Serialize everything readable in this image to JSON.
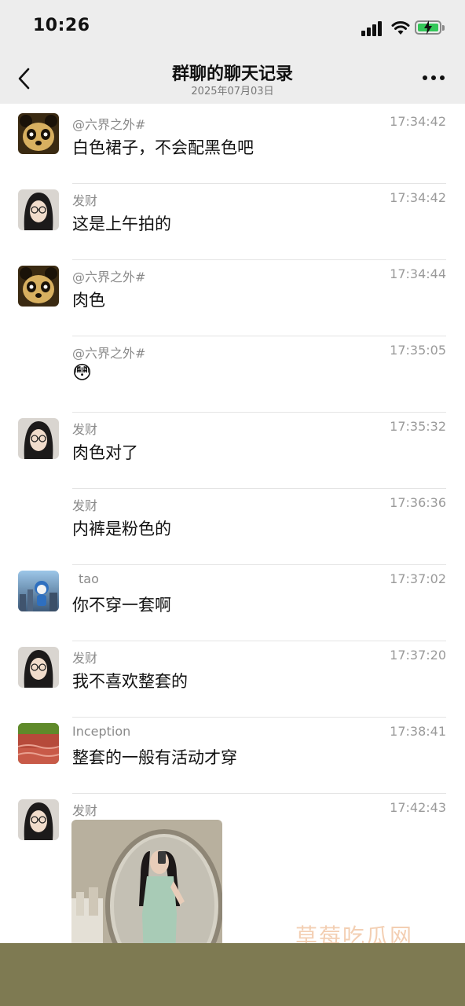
{
  "status_bar": {
    "time": "10:26",
    "icons": [
      "cellular-signal-icon",
      "wifi-icon",
      "battery-charging-icon"
    ]
  },
  "nav": {
    "back_icon": "chevron-left-icon",
    "title": "群聊的聊天记录",
    "date": "2025年07月03日",
    "more_icon": "more-dots-icon"
  },
  "messages": [
    {
      "sender": "@六界之外#",
      "time": "17:34:42",
      "text": "白色裙子，不会配黑色吧",
      "avatar": "panda-avatar"
    },
    {
      "sender": "发财",
      "time": "17:34:42",
      "text": "这是上午拍的",
      "avatar": "girl-avatar"
    },
    {
      "sender": "@六界之外#",
      "time": "17:34:44",
      "text": "肉色",
      "avatar": "panda-avatar"
    },
    {
      "sender": "@六界之外#",
      "time": "17:35:05",
      "text": "😳",
      "avatar": ""
    },
    {
      "sender": "发财",
      "time": "17:35:32",
      "text": "肉色对了",
      "avatar": "girl-avatar"
    },
    {
      "sender": "发财",
      "time": "17:36:36",
      "text": "内裤是粉色的",
      "avatar": ""
    },
    {
      "sender": "tao",
      "time": "17:37:02",
      "text": "你不穿一套啊",
      "avatar": "robot-city-avatar"
    },
    {
      "sender": "发财",
      "time": "17:37:20",
      "text": "我不喜欢整套的",
      "avatar": "girl-avatar"
    },
    {
      "sender": "Inception",
      "time": "17:38:41",
      "text": "整套的一般有活动才穿",
      "avatar": "landscape-avatar"
    },
    {
      "sender": "发财",
      "time": "17:42:43",
      "text": "",
      "avatar": "girl-avatar",
      "image": "mirror-selfie-photo"
    }
  ],
  "watermark": "草莓吃瓜网",
  "colors": {
    "topbar": "#ededed",
    "background": "#ffffff",
    "name_text": "#8a8a8a",
    "time_text": "#9a9a9a",
    "battery": "#34c759",
    "bottom_band": "#7e7a52"
  }
}
